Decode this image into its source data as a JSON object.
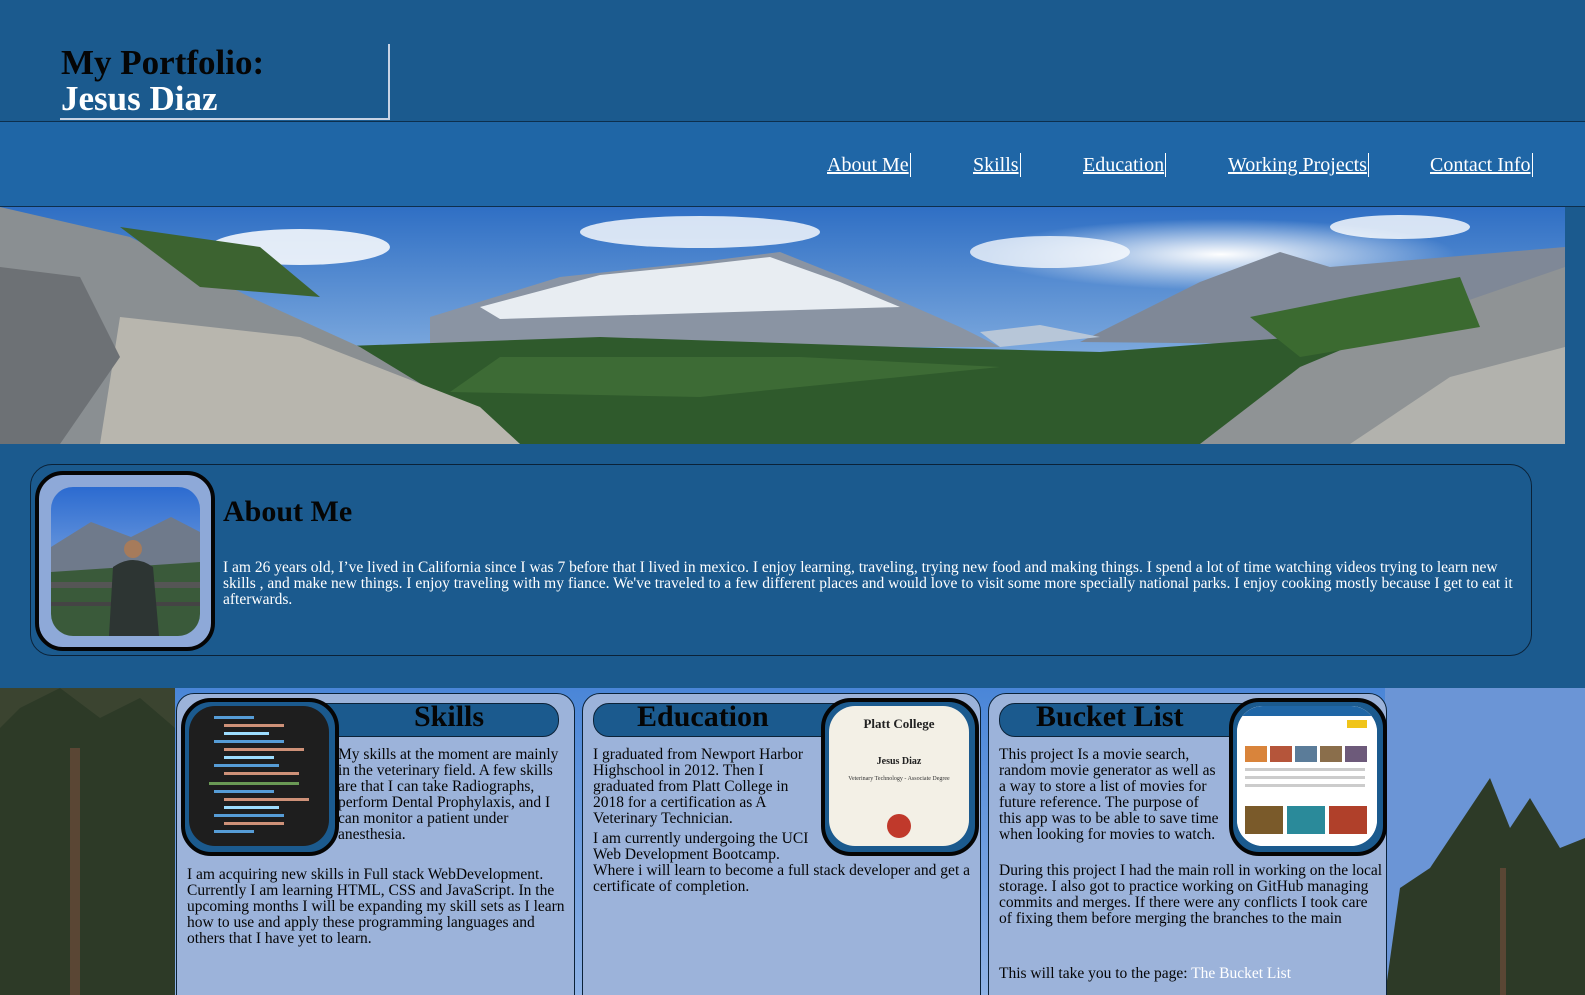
{
  "header": {
    "title_line1": "My Portfolio:",
    "title_line2": "Jesus Diaz"
  },
  "nav": {
    "items": [
      {
        "label": "About Me"
      },
      {
        "label": "Skills"
      },
      {
        "label": "Education"
      },
      {
        "label": "Working Projects"
      },
      {
        "label": "Contact Info"
      }
    ]
  },
  "about": {
    "title": "About Me",
    "text": "I am 26 years old, I’ve lived in California since I was 7 before that I lived in mexico. I enjoy learning, traveling, trying new food and making things. I spend a lot of time watching videos trying to learn new skills , and make new things. I enjoy traveling with my fiance. We've traveled to a few different places and would love to visit some more specially national parks. I enjoy cooking mostly because I get to eat it afterwards."
  },
  "skills": {
    "title": "Skills",
    "paragraph1": "My skills at the moment are mainly in the veterinary field. A few skills are that I can take Radiographs, perform Dental Prophylaxis, and I can monitor a patient under anesthesia.",
    "paragraph2": "I am acquiring new skills in Full stack WebDevelopment. Currently I am learning HTML, CSS and JavaScript. In the upcoming months I will be expanding my skill sets as I learn how to use and apply these programming languages and others that I have yet to learn."
  },
  "education": {
    "title": "Education",
    "paragraph1": "I graduated from Newport Harbor Highschool in 2012. Then I graduated from Platt College in 2018 for a certification as A Veterinary Technician.",
    "paragraph2_line1": "I am currently undergoing the UCI Web Development Bootcamp.",
    "paragraph2_line2": "Where i will learn to become a full stack developer and get a certificate of completion.",
    "certificate": {
      "school": "Platt College",
      "name": "Jesus Diaz",
      "program": "Veterinary Technology - Associate Degree"
    }
  },
  "bucket_list": {
    "title": "Bucket List",
    "paragraph1": "This project Is a movie search, random movie generator as well as a way to store a list of movies for future reference. The purpose of this app was to be able to save time when looking for movies to watch.",
    "paragraph2": "During this project I had the main roll in working on the local storage. I also got to practice working on GitHub managing commits and merges. If there were any conflicts I took care of fixing them before merging the branches to the main",
    "link_prefix": "This will take you to the page: ",
    "link_label": "The Bucket List"
  },
  "colors": {
    "header_bg": "#1b5a8e",
    "nav_bg": "#1f66a6",
    "card_bg": "#9cb3da",
    "text_white": "#ffffff",
    "text_dark": "#050505"
  }
}
